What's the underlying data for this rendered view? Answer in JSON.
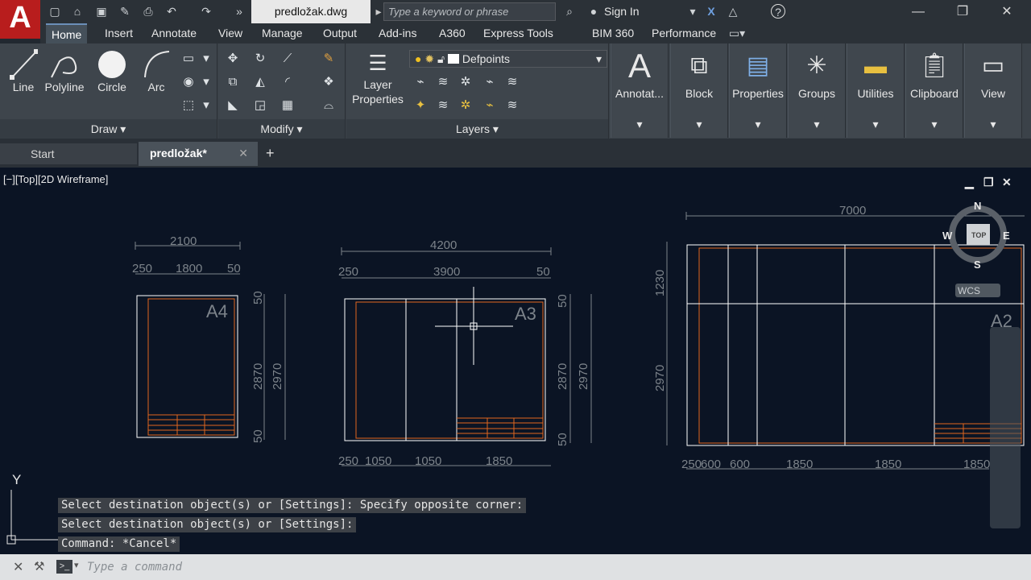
{
  "app": {
    "logo": "A",
    "document_title": "predložak.dwg",
    "search_placeholder": "Type a keyword or phrase",
    "sign_in": "Sign In"
  },
  "ribbon_tabs": [
    "Home",
    "Insert",
    "Annotate",
    "View",
    "Manage",
    "Output",
    "Add-ins",
    "A360",
    "Express Tools",
    "BIM 360",
    "Performance"
  ],
  "draw_panel": {
    "title": "Draw",
    "tools": [
      "Line",
      "Polyline",
      "Circle",
      "Arc"
    ]
  },
  "modify_panel": {
    "title": "Modify"
  },
  "layers_panel": {
    "title": "Layers",
    "layer_properties": "Layer\nProperties",
    "current_layer": "Defpoints"
  },
  "big_buttons": [
    "Annotat...",
    "Block",
    "Properties",
    "Groups",
    "Utilities",
    "Clipboard",
    "View"
  ],
  "doc_tabs": {
    "start": "Start",
    "active": "predložak*"
  },
  "viewport": {
    "label": "[−][Top][2D Wireframe]",
    "viewcube": {
      "n": "N",
      "s": "S",
      "e": "E",
      "w": "W",
      "top": "TOP",
      "ucs": "WCS"
    }
  },
  "drawings": {
    "a4": {
      "name": "A4",
      "total": "2100",
      "segments": [
        "250",
        "1800",
        "50"
      ],
      "v_total": "2970",
      "v_inner": "2870",
      "v_top": "50",
      "v_bottom": "50"
    },
    "a3": {
      "name": "A3",
      "total": "4200",
      "segments": [
        "250",
        "3900",
        "50"
      ],
      "bottom": [
        "250",
        "1050",
        "1050",
        "1850"
      ],
      "v_total": "2970",
      "v_inner": "2870",
      "v_top": "50",
      "v_bottom": "50"
    },
    "a2": {
      "name": "A2",
      "total": "7000",
      "v_top": "1230",
      "v_main": "2970",
      "bottom": [
        "250",
        "600",
        "600",
        "1850",
        "1850",
        "1850"
      ]
    }
  },
  "command_history": [
    "Select destination object(s) or [Settings]: Specify opposite corner:",
    "Select destination object(s) or [Settings]:",
    "Command: *Cancel*"
  ],
  "command_placeholder": "Type a command",
  "ucs_axis": "Y",
  "colors": {
    "canvas": "#0b1424",
    "orange": "#e0661e",
    "dim": "#7c838a",
    "accent": "#b81d1d"
  }
}
